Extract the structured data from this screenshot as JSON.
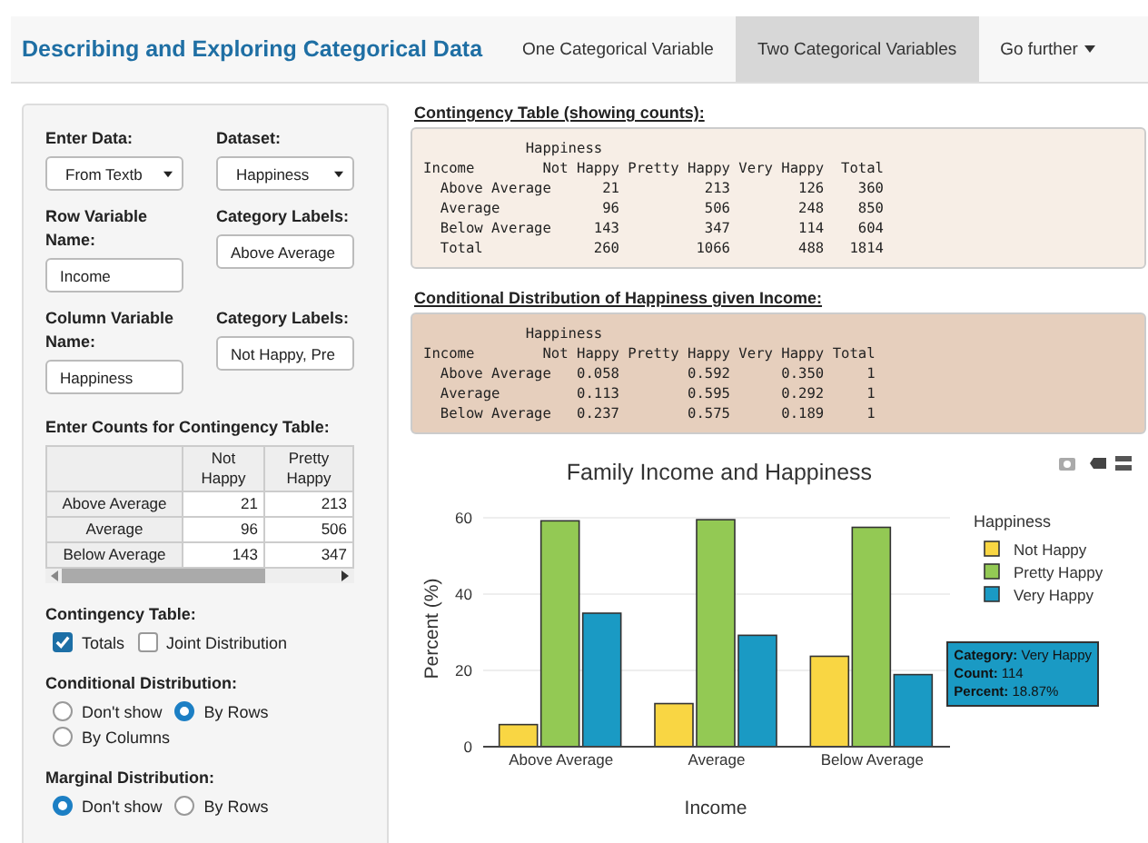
{
  "nav": {
    "title": "Describing and Exploring Categorical Data",
    "tabs": [
      {
        "label": "One Categorical Variable",
        "selected": false,
        "dropdown": false
      },
      {
        "label": "Two Categorical Variables",
        "selected": true,
        "dropdown": false
      },
      {
        "label": "Go further",
        "selected": false,
        "dropdown": true
      }
    ]
  },
  "sidebar": {
    "fields": [
      {
        "label": "Enter Data:",
        "kind": "select",
        "value": "From Textb"
      },
      {
        "label": "Dataset:",
        "kind": "select",
        "value": "Happiness"
      },
      {
        "label": "Row Variable Name:",
        "kind": "input",
        "value": "Income"
      },
      {
        "label": "Category Labels:",
        "kind": "input",
        "value": "Above Average"
      },
      {
        "label": "Column Variable Name:",
        "kind": "input",
        "value": "Happiness"
      },
      {
        "label": "Category Labels:",
        "kind": "input",
        "value": "Not Happy, Pre"
      }
    ],
    "counts": {
      "title": "Enter Counts for Contingency Table:",
      "columns": [
        "Not Happy",
        "Pretty Happy"
      ],
      "rows": [
        {
          "label": "Above Average",
          "values": [
            "21",
            "213"
          ]
        },
        {
          "label": "Average",
          "values": [
            "96",
            "506"
          ]
        },
        {
          "label": "Below Average",
          "values": [
            "143",
            "347"
          ]
        }
      ]
    },
    "groups": [
      {
        "title": "Contingency Table:",
        "kind": "checkbox",
        "options": [
          {
            "label": "Totals",
            "checked": true
          },
          {
            "label": "Joint Distribution",
            "checked": false
          }
        ]
      },
      {
        "title": "Conditional Distribution:",
        "kind": "radio",
        "options": [
          {
            "label": "Don't show",
            "checked": false
          },
          {
            "label": "By Rows",
            "checked": true
          },
          {
            "label": "By Columns",
            "checked": false
          }
        ]
      },
      {
        "title": "Marginal Distribution:",
        "kind": "radio",
        "options": [
          {
            "label": "Don't show",
            "checked": true
          },
          {
            "label": "By Rows",
            "checked": false
          }
        ]
      }
    ]
  },
  "outputs": [
    {
      "title": "Contingency Table (showing counts):",
      "kind": "light",
      "lines": [
        "            Happiness",
        "Income        Not Happy Pretty Happy Very Happy  Total",
        "  Above Average      21          213        126    360",
        "  Average            96          506        248    850",
        "  Below Average     143          347        114    604",
        "  Total             260         1066        488   1814"
      ]
    },
    {
      "title": "Conditional Distribution of Happiness given Income:",
      "kind": "dark",
      "lines": [
        "            Happiness",
        "Income        Not Happy Pretty Happy Very Happy Total",
        "  Above Average   0.058        0.592      0.350     1",
        "  Average         0.113        0.595      0.292     1",
        "  Below Average   0.237        0.575      0.189     1"
      ]
    }
  ],
  "chart": {
    "legend_title": "Happiness",
    "chart_data": {
      "type": "bar",
      "title": "Family Income and Happiness",
      "xlabel": "Income",
      "ylabel": "Percent (%)",
      "categories": [
        "Above Average",
        "Average",
        "Below Average"
      ],
      "series": [
        {
          "name": "Not Happy",
          "color": "#f9d643",
          "values": [
            5.8,
            11.3,
            23.7
          ]
        },
        {
          "name": "Pretty Happy",
          "color": "#93c954",
          "values": [
            59.2,
            59.5,
            57.5
          ]
        },
        {
          "name": "Very Happy",
          "color": "#1a9ac4",
          "values": [
            35.0,
            29.2,
            18.9
          ]
        }
      ],
      "ylim": [
        0,
        60
      ],
      "yticks": [
        0,
        20,
        40,
        60
      ],
      "grid": true,
      "legend": true
    },
    "tooltip": {
      "lines": [
        "**Category:** Very Happy",
        "**Count:** 114",
        "**Percent:** 18.87%"
      ]
    }
  }
}
